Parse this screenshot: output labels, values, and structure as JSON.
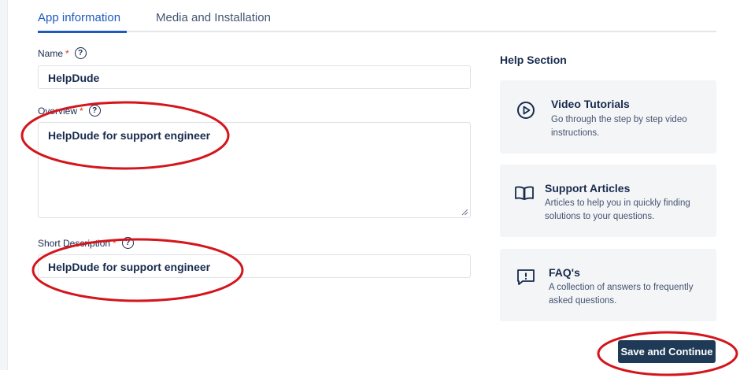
{
  "tabs": [
    {
      "label": "App information"
    },
    {
      "label": "Media and Installation"
    }
  ],
  "form": {
    "name": {
      "label": "Name",
      "required": "*",
      "value": "HelpDude"
    },
    "overview": {
      "label": "Overview",
      "required": "*",
      "value": "HelpDude for support engineer"
    },
    "short_description": {
      "label": "Short Description",
      "required": "*",
      "value": "HelpDude for support engineer"
    }
  },
  "help": {
    "title": "Help Section",
    "cards": [
      {
        "icon": "play-circle-icon",
        "title": "Video Tutorials",
        "description": "Go through the step by step video instructions."
      },
      {
        "icon": "book-icon",
        "title": "Support Articles",
        "description": "Articles to help you in quickly finding solutions to your questions."
      },
      {
        "icon": "message-alert-icon",
        "title": "FAQ's",
        "description": "A collection of answers to frequently asked questions."
      }
    ]
  },
  "actions": {
    "save_label": "Save and Continue"
  },
  "colors": {
    "accent": "#1d5bbf",
    "button": "#1e3a56",
    "annotation": "#d4151c",
    "card_bg": "#f4f5f7"
  }
}
